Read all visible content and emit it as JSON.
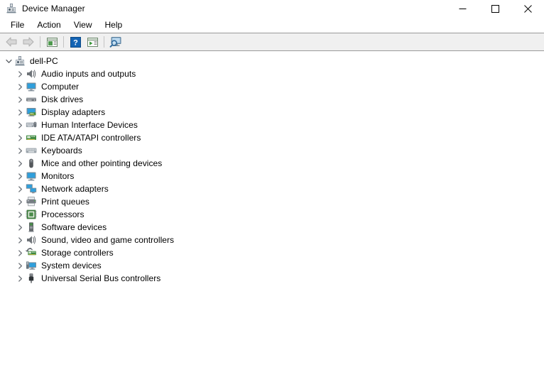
{
  "window": {
    "title": "Device Manager",
    "icon": "device-manager-icon",
    "controls": {
      "minimize": "minimize-icon",
      "maximize": "maximize-icon",
      "close": "close-icon"
    }
  },
  "menubar": {
    "items": [
      {
        "label": "File"
      },
      {
        "label": "Action"
      },
      {
        "label": "View"
      },
      {
        "label": "Help"
      }
    ]
  },
  "toolbar": {
    "buttons": [
      {
        "name": "back-button",
        "icon": "back-arrow-icon",
        "enabled": false
      },
      {
        "name": "forward-button",
        "icon": "forward-arrow-icon",
        "enabled": false
      },
      {
        "name": "properties-button",
        "icon": "properties-window-icon",
        "enabled": true
      },
      {
        "name": "help-button",
        "icon": "help-question-icon",
        "enabled": true
      },
      {
        "name": "update-driver-button",
        "icon": "play-window-icon",
        "enabled": true
      },
      {
        "name": "scan-hardware-button",
        "icon": "monitor-magnifier-icon",
        "enabled": true
      }
    ]
  },
  "tree": {
    "root": {
      "label": "dell-PC",
      "icon": "computer-root-icon",
      "expanded": true
    },
    "items": [
      {
        "label": "Audio inputs and outputs",
        "icon": "speaker-icon"
      },
      {
        "label": "Computer",
        "icon": "monitor-icon"
      },
      {
        "label": "Disk drives",
        "icon": "disk-drive-icon"
      },
      {
        "label": "Display adapters",
        "icon": "display-adapter-icon"
      },
      {
        "label": "Human Interface Devices",
        "icon": "hid-icon"
      },
      {
        "label": "IDE ATA/ATAPI controllers",
        "icon": "ide-controller-icon"
      },
      {
        "label": "Keyboards",
        "icon": "keyboard-icon"
      },
      {
        "label": "Mice and other pointing devices",
        "icon": "mouse-icon"
      },
      {
        "label": "Monitors",
        "icon": "monitor-icon"
      },
      {
        "label": "Network adapters",
        "icon": "network-adapter-icon"
      },
      {
        "label": "Print queues",
        "icon": "printer-icon"
      },
      {
        "label": "Processors",
        "icon": "processor-icon"
      },
      {
        "label": "Software devices",
        "icon": "software-device-icon"
      },
      {
        "label": "Sound, video and game controllers",
        "icon": "speaker-icon"
      },
      {
        "label": "Storage controllers",
        "icon": "storage-controller-icon"
      },
      {
        "label": "System devices",
        "icon": "system-device-icon"
      },
      {
        "label": "Universal Serial Bus controllers",
        "icon": "usb-icon"
      }
    ]
  },
  "colors": {
    "accent_blue": "#3b97d3",
    "chip_green": "#3f7d3f",
    "toolbar_bg": "#f0f0f0",
    "separator": "#9a9a9a"
  }
}
